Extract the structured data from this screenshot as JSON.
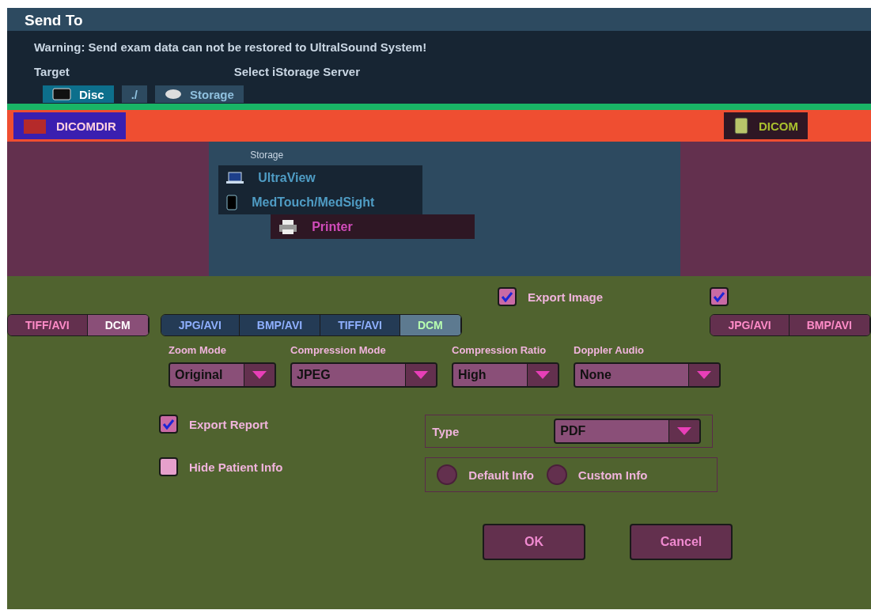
{
  "window": {
    "title": "Send To"
  },
  "warning": "Warning: Send exam data can not be restored to UltralSound System!",
  "target_label": "Target",
  "server_label": "Select iStorage Server",
  "targets": [
    {
      "label": "Disc",
      "kind": "disc",
      "selected": true
    },
    {
      "label": "./",
      "kind": "path",
      "selected": false
    },
    {
      "label": "Storage",
      "kind": "storage",
      "selected": false
    }
  ],
  "formats_row": [
    {
      "label": "DICOMDIR",
      "kind": "dicomdir"
    },
    {
      "label": "DICOM",
      "kind": "dicom"
    }
  ],
  "menu": {
    "header": "Storage",
    "items": [
      {
        "label": "UltraView",
        "kind": "laptop",
        "selected": false
      },
      {
        "label": "MedTouch/MedSight",
        "kind": "tablet",
        "selected": false
      },
      {
        "label": "Printer",
        "kind": "printer",
        "selected": true
      }
    ]
  },
  "export_image": {
    "label": "Export Image",
    "checked": true
  },
  "export_other": {
    "checked": true
  },
  "left_formats": [
    {
      "label": "TIFF/AVI",
      "selected": false
    },
    {
      "label": "DCM",
      "selected": true
    }
  ],
  "tabs": [
    {
      "label": "JPG/AVI",
      "selected": false
    },
    {
      "label": "BMP/AVI",
      "selected": false
    },
    {
      "label": "TIFF/AVI",
      "selected": false
    },
    {
      "label": "DCM",
      "selected": true
    }
  ],
  "right_formats": [
    {
      "label": "JPG/AVI",
      "selected": false
    },
    {
      "label": "BMP/AVI",
      "selected": false
    }
  ],
  "field_labels": [
    "Zoom Mode",
    "Compression Mode",
    "Compression Ratio",
    "Doppler Audio"
  ],
  "selects": [
    {
      "value": "Original"
    },
    {
      "value": "JPEG"
    },
    {
      "value": "High"
    },
    {
      "value": "None"
    }
  ],
  "export_report": {
    "label": "Export Report",
    "checked": true
  },
  "hide_patient": {
    "label": "Hide Patient Info",
    "checked": false
  },
  "type": {
    "label": "Type",
    "value": "PDF"
  },
  "info_options": [
    {
      "label": "Default Info",
      "selected": false
    },
    {
      "label": "Custom Info",
      "selected": false
    }
  ],
  "buttons": [
    {
      "label": "OK"
    },
    {
      "label": "Cancel"
    }
  ]
}
